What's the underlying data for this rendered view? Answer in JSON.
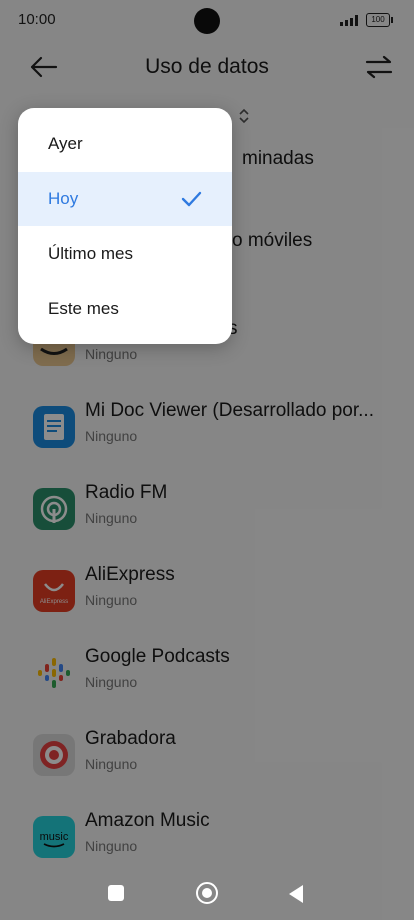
{
  "status_bar": {
    "time": "10:00",
    "battery": "100"
  },
  "header": {
    "title": "Uso de datos"
  },
  "background_fragments": [
    "minadas",
    "o móviles",
    "s"
  ],
  "apps": [
    {
      "name": "",
      "usage": "Ninguno",
      "icon": "amazon-shopping-icon"
    },
    {
      "name": "Mi Doc Viewer (Desarrollado por...",
      "usage": "Ninguno",
      "icon": "doc-viewer-icon"
    },
    {
      "name": "Radio FM",
      "usage": "Ninguno",
      "icon": "radio-icon"
    },
    {
      "name": "AliExpress",
      "usage": "Ninguno",
      "icon": "aliexpress-icon",
      "icon_text": "AliExpress"
    },
    {
      "name": "Google Podcasts",
      "usage": "Ninguno",
      "icon": "podcasts-icon"
    },
    {
      "name": "Grabadora",
      "usage": "Ninguno",
      "icon": "recorder-icon"
    },
    {
      "name": "Amazon Music",
      "usage": "Ninguno",
      "icon": "amazon-music-icon",
      "icon_text": "music"
    }
  ],
  "period_menu": {
    "options": [
      {
        "label": "Ayer",
        "selected": false
      },
      {
        "label": "Hoy",
        "selected": true
      },
      {
        "label": "Último mes",
        "selected": false
      },
      {
        "label": "Este mes",
        "selected": false
      }
    ]
  },
  "colors": {
    "accent": "#2f7ae0",
    "selected_bg": "#e6f0fd",
    "scrim": "rgba(0,0,0,0.45)"
  }
}
